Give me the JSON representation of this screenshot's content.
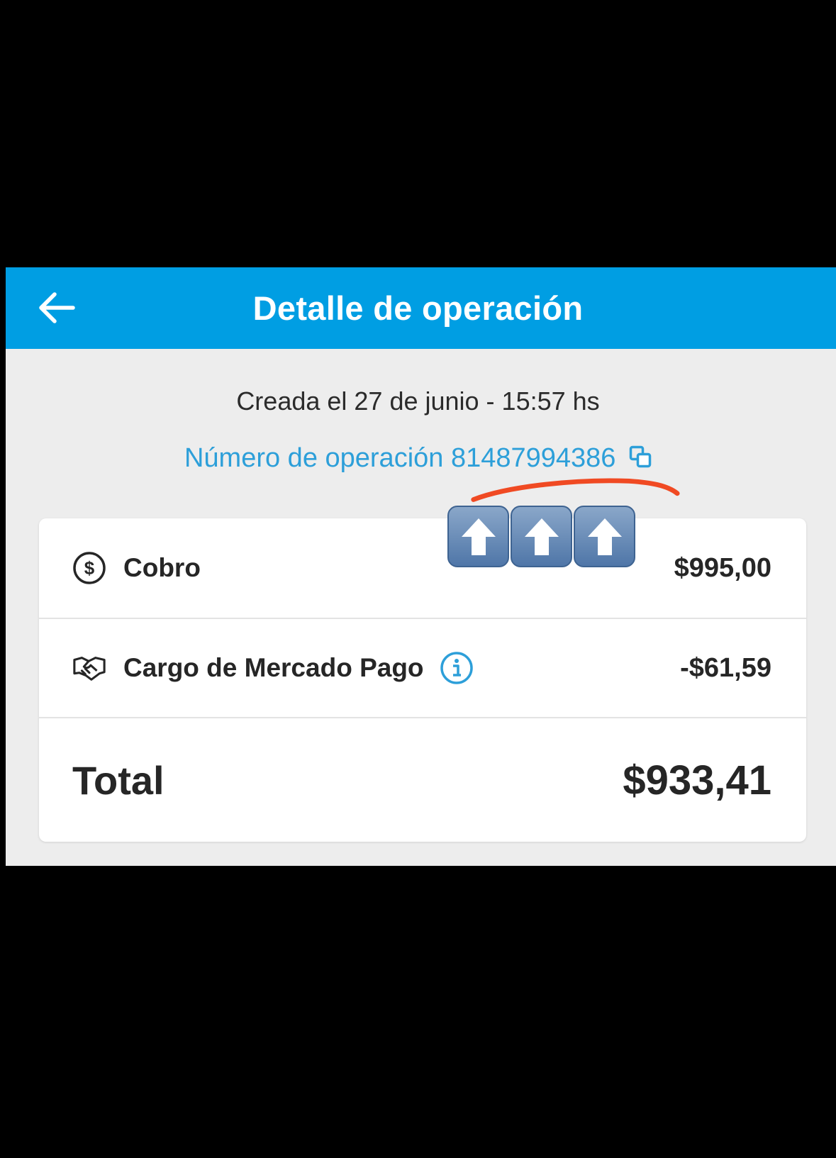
{
  "header": {
    "title": "Detalle de operación",
    "back_icon": "arrow-left-icon",
    "bg_color": "#009ee3"
  },
  "created_text": "Creada el 27 de junio - 15:57 hs",
  "operation": {
    "label": "Número de operación",
    "number": "81487994386",
    "copy_icon": "copy-icon",
    "link_color": "#2d9fd9"
  },
  "annotation": {
    "underline_color": "#f04a23",
    "arrow_icon": "up-arrow-emoji-icon",
    "arrow_count": 3
  },
  "rows": [
    {
      "icon": "dollar-circle-icon",
      "label": "Cobro",
      "amount": "$995,00"
    },
    {
      "icon": "handshake-icon",
      "label": "Cargo de Mercado Pago",
      "info_icon": "info-icon",
      "amount": "-$61,59"
    }
  ],
  "total": {
    "label": "Total",
    "amount": "$933,41"
  }
}
